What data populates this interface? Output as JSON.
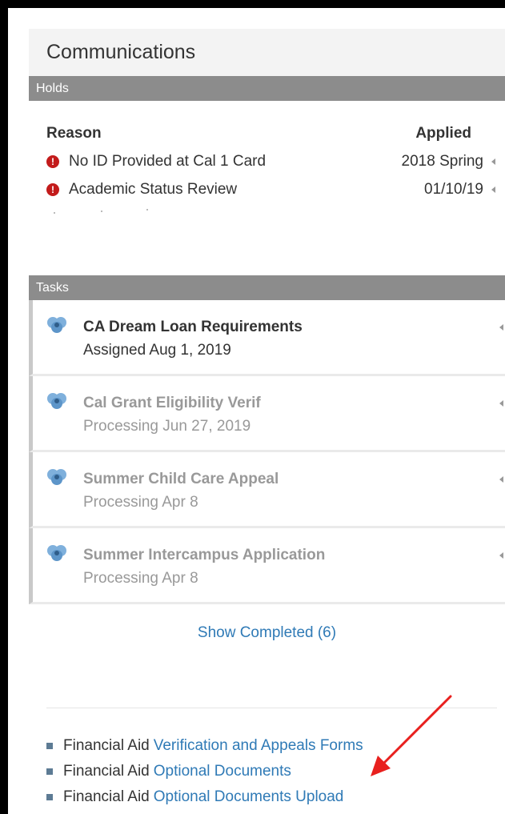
{
  "communications": {
    "title": "Communications"
  },
  "holds": {
    "section_label": "Holds",
    "headers": {
      "reason": "Reason",
      "applied": "Applied"
    },
    "items": [
      {
        "reason": "No ID Provided at Cal 1 Card",
        "applied": "2018 Spring"
      },
      {
        "reason": "Academic Status Review",
        "applied": "01/10/19"
      }
    ]
  },
  "tasks": {
    "section_label": "Tasks",
    "items": [
      {
        "name": "CA Dream Loan Requirements",
        "status": "Assigned Aug 1, 2019"
      },
      {
        "name": "Cal Grant Eligibility Verif",
        "status": "Processing Jun 27, 2019"
      },
      {
        "name": "Summer Child Care Appeal",
        "status": "Processing Apr 8"
      },
      {
        "name": "Summer Intercampus Application",
        "status": "Processing Apr 8"
      }
    ],
    "show_completed": "Show Completed (6)"
  },
  "links": [
    {
      "prefix": "Financial Aid",
      "link": "Verification and Appeals Forms"
    },
    {
      "prefix": "Financial Aid",
      "link": "Optional Documents"
    },
    {
      "prefix": "Financial Aid",
      "link": "Optional Documents Upload"
    }
  ],
  "colors": {
    "link": "#2f7ab6",
    "alert": "#c31b1b",
    "section_bar": "#8c8c8c",
    "annotation_arrow": "#e8201e"
  }
}
